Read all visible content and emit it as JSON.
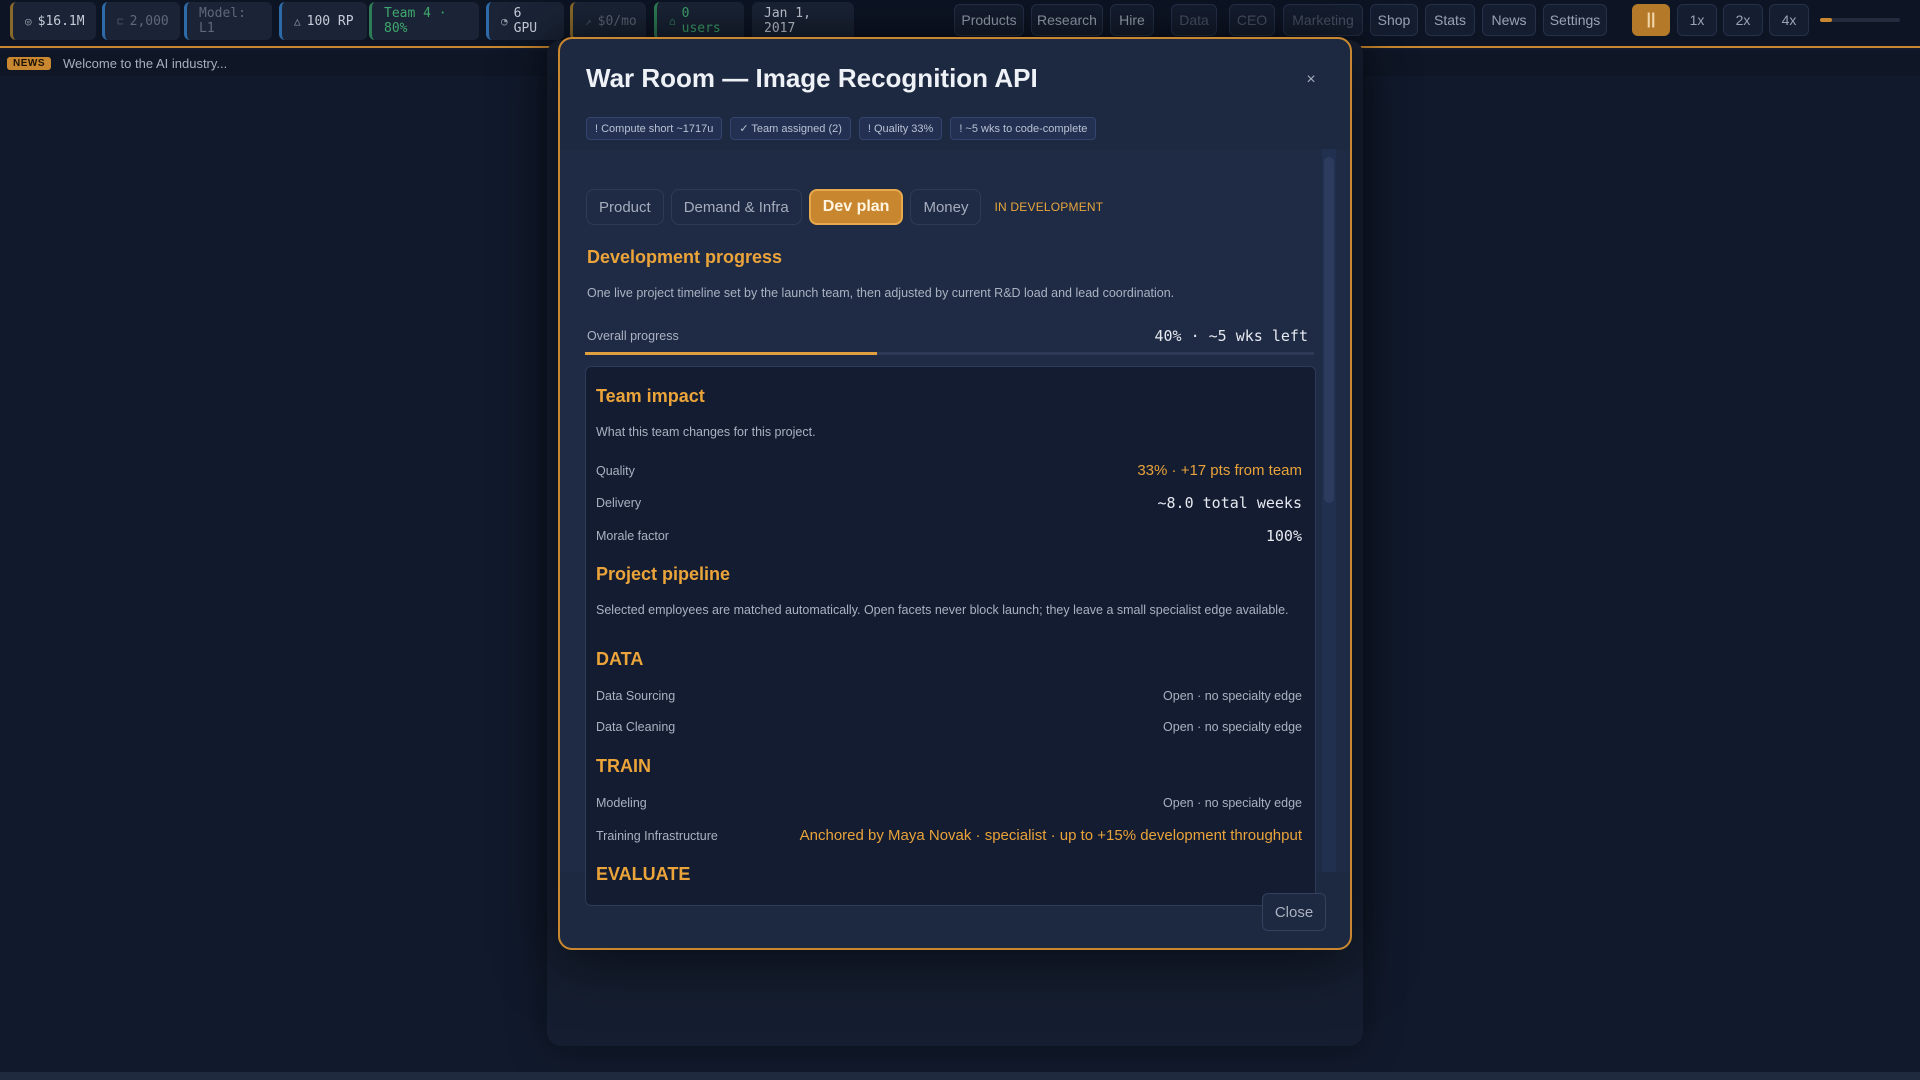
{
  "topbar": {
    "stats": [
      {
        "icon": "coin-icon",
        "value": "$16.1M"
      },
      {
        "icon": "data-icon",
        "value": "2,000"
      },
      {
        "icon": "model-icon",
        "value": "Model: L1"
      },
      {
        "icon": "flask-icon",
        "value": "100 RP"
      },
      {
        "icon": "team-icon",
        "value": "Team 4 · 80%"
      },
      {
        "icon": "gpu-icon",
        "value": "6 GPU"
      },
      {
        "icon": "revenue-icon",
        "value": "$0/mo"
      },
      {
        "icon": "users-icon",
        "value": "0 users"
      },
      {
        "icon": "",
        "value": "Jan 1, 2017"
      }
    ],
    "nav": [
      "Products",
      "Research",
      "Hire",
      "Data",
      "CEO",
      "Marketing",
      "Shop",
      "Stats",
      "News",
      "Settings"
    ],
    "pause_label": "||",
    "speeds": [
      "1x",
      "2x",
      "4x"
    ],
    "speed_level": 0.15
  },
  "news": {
    "badge": "NEWS",
    "text": "Welcome to the AI industry..."
  },
  "modal": {
    "title": "War Room — Image Recognition API",
    "close_glyph": "×",
    "chips": [
      "! Compute short ~1717u",
      "✓ Team assigned (2)",
      "! Quality 33%",
      "! ~5 wks to code-complete"
    ],
    "tabs": [
      "Product",
      "Demand & Infra",
      "Dev plan",
      "Money"
    ],
    "active_tab": "Dev plan",
    "status": "IN DEVELOPMENT",
    "dev": {
      "title": "Development progress",
      "description": "One live project timeline set by the launch team, then adjusted by current R&D load and lead coordination.",
      "progress_label": "Overall progress",
      "progress_value": "40% · ~5 wks left",
      "progress": 0.4
    },
    "impact": {
      "title": "Team impact",
      "description": "What this team changes for this project.",
      "rows": [
        {
          "label": "Quality",
          "value": "33% · +17 pts from team"
        },
        {
          "label": "Delivery",
          "value": "~8.0 total weeks"
        },
        {
          "label": "Morale factor",
          "value": "100%"
        }
      ]
    },
    "pipeline": {
      "title": "Project pipeline",
      "description": "Selected employees are matched automatically. Open facets never block launch; they leave a small specialist edge available.",
      "stages": [
        {
          "name": "DATA",
          "rows": [
            {
              "label": "Data Sourcing",
              "value": "Open · no specialty edge"
            },
            {
              "label": "Data Cleaning",
              "value": "Open · no specialty edge"
            }
          ]
        },
        {
          "name": "TRAIN",
          "rows": [
            {
              "label": "Modeling",
              "value": "Open · no specialty edge"
            },
            {
              "label": "Training Infrastructure",
              "value": "Anchored by Maya Novak · specialist · up to +15% development throughput"
            }
          ]
        },
        {
          "name": "EVALUATE",
          "rows": []
        }
      ]
    },
    "footer_close": "Close"
  }
}
